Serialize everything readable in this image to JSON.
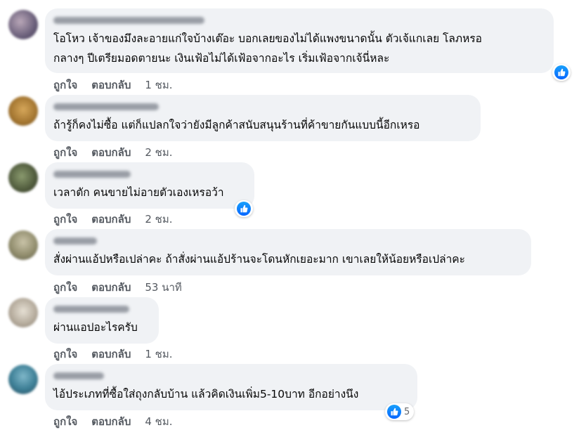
{
  "comments": [
    {
      "text": "โอโหว เจ้าของมึงละอายแก่ใจบ้างเต๊อะ บอกเลยของไม่ได้แพงขนาดนั้น ตัวเจ้แกเลย โลภหรอ\nกลางๆ ปีเตรียมอดตายนะ เงินเฟ้อไม่ได้เฟ้อจากอะไร เริ่มเฟ้อจากเจ้นี่หละ",
      "like_label": "ถูกใจ",
      "reply_label": "ตอบกลับ",
      "time": "1 ชม.",
      "reaction_icon": "like-icon"
    },
    {
      "text": "ถ้ารู้ก็คงไม่ซื้อ แต่ก็แปลกใจว่ายังมีลูกค้าสนับสนุนร้านที่ค้าขายกันแบบนี้อีกเหรอ",
      "like_label": "ถูกใจ",
      "reply_label": "ตอบกลับ",
      "time": "2 ชม."
    },
    {
      "text": "เวลาตัก คนขายไม่อายตัวเองเหรอว้า",
      "like_label": "ถูกใจ",
      "reply_label": "ตอบกลับ",
      "time": "2 ชม.",
      "reaction_icon": "like-icon"
    },
    {
      "text": "สั่งผ่านแอ้ปหรือเปล่าคะ ถ้าสั่งผ่านแอ้ปร้านจะโดนหักเยอะมาก เขาเลยให้น้อยหรือเปล่าคะ",
      "like_label": "ถูกใจ",
      "reply_label": "ตอบกลับ",
      "time": "53 นาที"
    },
    {
      "text": "ผ่านแอปอะไรครับ",
      "like_label": "ถูกใจ",
      "reply_label": "ตอบกลับ",
      "time": "1 ชม."
    },
    {
      "text": "ไอ้ประเภทที่ซื้อใส่ถุงกลับบ้าน แล้วคิดเงินเพิ่ม5-10บาท อีกอย่างนึง",
      "like_label": "ถูกใจ",
      "reply_label": "ตอบกลับ",
      "time": "4 ชม.",
      "reaction_icon": "like-icon",
      "reaction_count": "5"
    }
  ],
  "colors": {
    "bubble": "#f0f2f5",
    "action_text": "#555a61",
    "like_blue": "#0866ff"
  }
}
